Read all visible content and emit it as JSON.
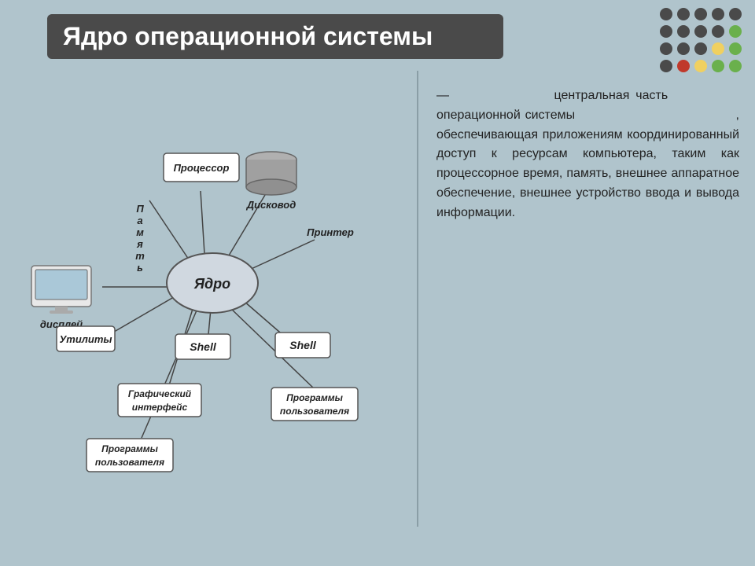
{
  "title": "Ядро операционной системы",
  "description_parts": [
    {
      "text": "— центральная часть операционной системы ",
      "bold": false
    },
    {
      "text": "",
      "bold": false
    },
    {
      "text": ", обеспечивающая приложениям координированный доступ к ресурсам компьютера, таким как процессорное время, память, внешнее аппаратное обеспечение, внешнее устройство ввода и вывода информации.",
      "bold": false
    }
  ],
  "description_full": "— центральная часть операционной системы , обеспечивающая приложениям координированный доступ к ресурсам компьютера, таким как процессорное время, память, внешнее аппаратное обеспечение, внешнее устройство ввода и вывода информации.",
  "center_node": "Ядро",
  "nodes": [
    {
      "id": "display",
      "label": "дисплей",
      "type": "device"
    },
    {
      "id": "memory",
      "label": "Память",
      "type": "label"
    },
    {
      "id": "processor",
      "label": "Процессор",
      "type": "box"
    },
    {
      "id": "disk",
      "label": "Дисковод",
      "type": "cylinder"
    },
    {
      "id": "printer",
      "label": "Принтер",
      "type": "label"
    },
    {
      "id": "shell1",
      "label": "Shell",
      "type": "box"
    },
    {
      "id": "shell2",
      "label": "Shell",
      "type": "box"
    },
    {
      "id": "utilities",
      "label": "Утилиты",
      "type": "box"
    },
    {
      "id": "gui",
      "label": "Графический интерфейс",
      "type": "box"
    },
    {
      "id": "userprogs1",
      "label": "Программы пользователя",
      "type": "box"
    },
    {
      "id": "userprogs2",
      "label": "Программы пользователя",
      "type": "box"
    }
  ],
  "dots": {
    "colors": [
      "dark",
      "dark",
      "dark",
      "dark",
      "dark",
      "dark",
      "dark",
      "dark",
      "dark",
      "green",
      "dark",
      "dark",
      "dark",
      "yellow",
      "green",
      "dark",
      "red",
      "yellow",
      "green",
      "green"
    ]
  }
}
